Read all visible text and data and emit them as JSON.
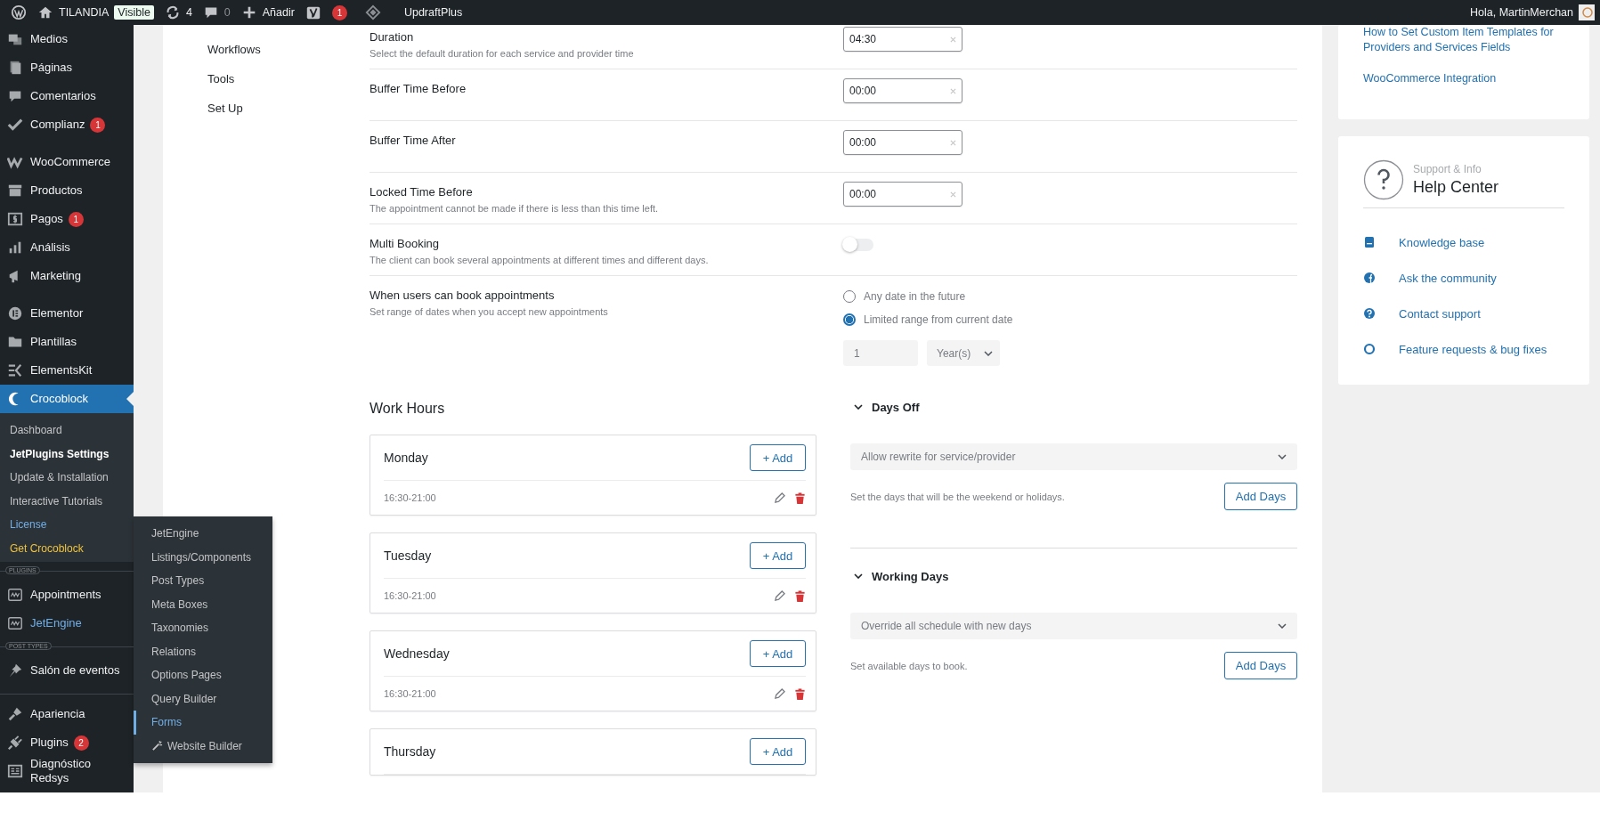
{
  "admin_bar": {
    "site_name": "TILANDIA",
    "site_status": "Visible",
    "updates": "4",
    "comments": "0",
    "new_label": "Añadir",
    "seo_notifications": "1",
    "backup_label": "UpdraftPlus",
    "greeting": "Hola, MartinMerchan"
  },
  "sidebar": {
    "groups": [
      {
        "items": [
          {
            "label": "Medios",
            "selected": false,
            "hovered": false
          },
          {
            "label": "Páginas",
            "selected": false,
            "hovered": false
          },
          {
            "label": "Comentarios",
            "selected": false,
            "hovered": false
          },
          {
            "label": "Complianz",
            "badge": "1",
            "selected": false,
            "hovered": false
          }
        ]
      },
      {
        "items": [
          {
            "label": "WooCommerce",
            "selected": false,
            "hovered": false
          },
          {
            "label": "Productos",
            "selected": false,
            "hovered": false
          },
          {
            "label": "Pagos",
            "badge": "1",
            "selected": false,
            "hovered": false
          },
          {
            "label": "Análisis",
            "selected": false,
            "hovered": false
          },
          {
            "label": "Marketing",
            "selected": false,
            "hovered": false
          }
        ]
      },
      {
        "items": [
          {
            "label": "Elementor",
            "selected": false,
            "hovered": false
          },
          {
            "label": "Plantillas",
            "selected": false,
            "hovered": false
          },
          {
            "label": "ElementsKit",
            "selected": false,
            "hovered": false
          },
          {
            "label": "Crocoblock",
            "selected": true,
            "hovered": false,
            "submenu": [
              {
                "label": "Dashboard",
                "kind": "normal"
              },
              {
                "label": "JetPlugins Settings",
                "kind": "current"
              },
              {
                "label": "Update & Installation",
                "kind": "normal"
              },
              {
                "label": "Interactive Tutorials",
                "kind": "normal"
              },
              {
                "label": "License",
                "kind": "license"
              },
              {
                "label": "Get Crocoblock",
                "kind": "promo"
              }
            ]
          }
        ]
      },
      {
        "heading": "PLUGINS",
        "items": [
          {
            "label": "Appointments",
            "selected": false,
            "hovered": false
          },
          {
            "label": "JetEngine",
            "selected": false,
            "hovered": true,
            "flyout": [
              {
                "label": "JetEngine",
                "selected": false,
                "kind": "plain"
              },
              {
                "label": "Listings/Components",
                "selected": false,
                "kind": "plain"
              },
              {
                "label": "Post Types",
                "selected": false,
                "kind": "plain"
              },
              {
                "label": "Meta Boxes",
                "selected": false,
                "kind": "plain"
              },
              {
                "label": "Taxonomies",
                "selected": false,
                "kind": "plain"
              },
              {
                "label": "Relations",
                "selected": false,
                "kind": "plain"
              },
              {
                "label": "Options Pages",
                "selected": false,
                "kind": "plain"
              },
              {
                "label": "Query Builder",
                "selected": false,
                "kind": "plain"
              },
              {
                "label": "Forms",
                "selected": true,
                "kind": "plain"
              },
              {
                "label": "Website Builder",
                "selected": false,
                "kind": "wizard"
              }
            ]
          }
        ]
      },
      {
        "heading": "POST TYPES",
        "items": [
          {
            "label": "Salón de eventos",
            "selected": false,
            "hovered": false
          }
        ]
      },
      {
        "items": [
          {
            "label": "Apariencia",
            "selected": false,
            "hovered": false
          },
          {
            "label": "Plugins",
            "badge": "2",
            "selected": false,
            "hovered": false
          },
          {
            "label": "Diagnóstico Redsys",
            "selected": false,
            "hovered": false
          }
        ]
      }
    ]
  },
  "subnav": [
    "Workflows",
    "Tools",
    "Set Up"
  ],
  "settings": [
    {
      "label": "Duration",
      "description": "Select the default duration for each service and provider time",
      "control": {
        "kind": "time",
        "value": "04:30"
      }
    },
    {
      "label": "Buffer Time Before",
      "control": {
        "kind": "time",
        "value": "00:00"
      }
    },
    {
      "label": "Buffer Time After",
      "control": {
        "kind": "time",
        "value": "00:00"
      }
    },
    {
      "label": "Locked Time Before",
      "description": "The appointment cannot be made if there is less than this time left.",
      "control": {
        "kind": "time",
        "value": "00:00"
      }
    },
    {
      "label": "Multi Booking",
      "description": "The client can book several appointments at different times and different days.",
      "control": {
        "kind": "toggle",
        "on": false
      }
    },
    {
      "label": "When users can book appointments",
      "description": "Set range of dates when you accept new appointments",
      "control": {
        "kind": "range",
        "options": [
          {
            "label": "Any date in the future",
            "selected": false
          },
          {
            "label": "Limited range from current date",
            "selected": true
          }
        ],
        "amount": "1",
        "unit": "Year(s)"
      }
    }
  ],
  "work_hours": {
    "title": "Work Hours",
    "days": [
      {
        "name": "Monday",
        "add_label": "+ Add",
        "slots": [
          "16:30-21:00"
        ]
      },
      {
        "name": "Tuesday",
        "add_label": "+ Add",
        "slots": [
          "16:30-21:00"
        ]
      },
      {
        "name": "Wednesday",
        "add_label": "+ Add",
        "slots": [
          "16:30-21:00"
        ]
      },
      {
        "name": "Thursday",
        "add_label": "+ Add"
      }
    ]
  },
  "schedule_sections": [
    {
      "title": "Days Off",
      "expanded": true,
      "select": "Allow rewrite for service/provider",
      "hint": "Set the days that will be the weekend or holidays.",
      "button": "Add Days"
    },
    {
      "title": "Working Days",
      "expanded": true,
      "select": "Override all schedule with new days",
      "hint": "Set available days to book.",
      "button": "Add Days"
    }
  ],
  "docs_links": [
    "How to Set Custom Item Templates for Providers and Services Fields",
    "WooCommerce Integration"
  ],
  "help_center": {
    "eyebrow": "Support & Info",
    "title": "Help Center",
    "links": [
      "Knowledge base",
      "Ask the community",
      "Contact support",
      "Feature requests & bug fixes"
    ]
  }
}
